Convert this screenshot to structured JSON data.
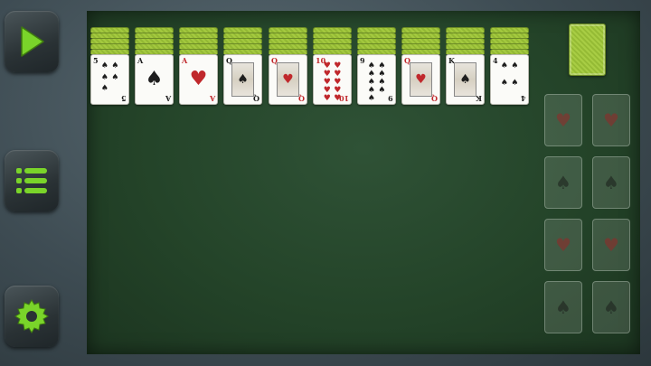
{
  "sidebar": {
    "play": {
      "icon": "play-icon",
      "color": "#7ad42a"
    },
    "menu": {
      "icon": "list-icon",
      "color": "#7ad42a"
    },
    "settings": {
      "icon": "gear-icon",
      "color": "#7ad42a"
    }
  },
  "card_back_color": "#a4c93f",
  "tableau": [
    {
      "rank": "5",
      "suit": "♠",
      "color": "black",
      "kind": "pips"
    },
    {
      "rank": "A",
      "suit": "♠",
      "color": "black",
      "kind": "ace"
    },
    {
      "rank": "A",
      "suit": "♥",
      "color": "red",
      "kind": "ace"
    },
    {
      "rank": "Q",
      "suit": "♠",
      "color": "black",
      "kind": "face"
    },
    {
      "rank": "Q",
      "suit": "♥",
      "color": "red",
      "kind": "face"
    },
    {
      "rank": "10",
      "suit": "♥",
      "color": "red",
      "kind": "pips"
    },
    {
      "rank": "9",
      "suit": "♠",
      "color": "black",
      "kind": "pips"
    },
    {
      "rank": "Q",
      "suit": "♥",
      "color": "red",
      "kind": "face"
    },
    {
      "rank": "K",
      "suit": "♠",
      "color": "black",
      "kind": "face"
    },
    {
      "rank": "4",
      "suit": "♠",
      "color": "black",
      "kind": "pips"
    }
  ],
  "foundations": [
    {
      "suit": "♥",
      "color": "red"
    },
    {
      "suit": "♥",
      "color": "red"
    },
    {
      "suit": "♠",
      "color": "black"
    },
    {
      "suit": "♠",
      "color": "black"
    },
    {
      "suit": "♥",
      "color": "red"
    },
    {
      "suit": "♥",
      "color": "red"
    },
    {
      "suit": "♠",
      "color": "black"
    },
    {
      "suit": "♠",
      "color": "black"
    }
  ]
}
